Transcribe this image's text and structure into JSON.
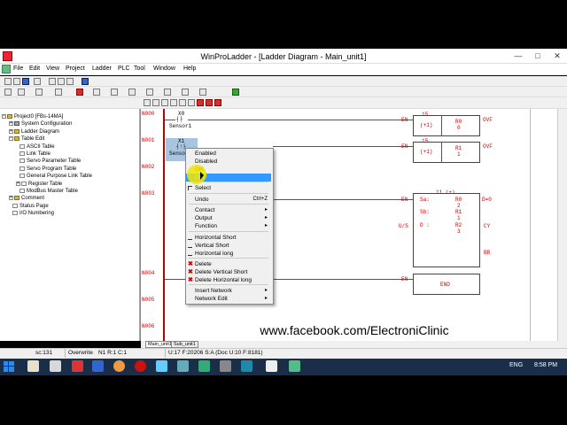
{
  "window": {
    "title": "WinProLadder - [Ladder Diagram - Main_unit1]",
    "minimize": "—",
    "maximize": "□",
    "close": "✕"
  },
  "menu": [
    "File",
    "Edit",
    "View",
    "Project",
    "Ladder",
    "PLC",
    "Tool",
    "Window",
    "Help"
  ],
  "tree": {
    "items": [
      {
        "label": "Project0 [FBs-14MA]",
        "icon": "folder-icon",
        "expander": "−"
      },
      {
        "label": "System Configuration",
        "icon": "gear-icon",
        "expander": "+"
      },
      {
        "label": "Ladder Diagram",
        "icon": "folder-icon",
        "expander": "+"
      },
      {
        "label": "Table Edit",
        "icon": "folder-icon",
        "expander": "−"
      },
      {
        "label": "ASCII Table",
        "icon": "doc-icon",
        "expander": ""
      },
      {
        "label": "Link Table",
        "icon": "doc-icon",
        "expander": ""
      },
      {
        "label": "Servo Parameter Table",
        "icon": "doc-icon",
        "expander": ""
      },
      {
        "label": "Servo Program Table",
        "icon": "doc-icon",
        "expander": ""
      },
      {
        "label": "General Purpose Link Table",
        "icon": "doc-icon",
        "expander": ""
      },
      {
        "label": "Register Table",
        "icon": "doc-icon",
        "expander": "+"
      },
      {
        "label": "ModBus Master Table",
        "icon": "doc-icon",
        "expander": ""
      },
      {
        "label": "Comment",
        "icon": "folder-icon",
        "expander": "+"
      },
      {
        "label": "Status Page",
        "icon": "doc-icon",
        "expander": ""
      },
      {
        "label": "I/O Numbering",
        "icon": "doc-icon",
        "expander": ""
      }
    ]
  },
  "ladder": {
    "rungs": [
      "N000",
      "N001",
      "N002",
      "N003",
      "N004",
      "N005",
      "N006"
    ],
    "contact0": {
      "address": "X0",
      "symbol": "┤├",
      "comment": "Sensor1"
    },
    "contact1": {
      "address": "X1",
      "symbol": "┤↑├",
      "comment": "Sensor"
    },
    "fb1": {
      "number": "15",
      "op": "(+1)",
      "reg": "R0",
      "idx": "0",
      "en": "EN",
      "out": "OVF"
    },
    "fb2": {
      "number": "15",
      "op": "(+1)",
      "reg": "R1",
      "idx": "1",
      "en": "EN",
      "out": "OVF"
    },
    "fb3": {
      "number": "11.(+)",
      "en": "EN",
      "us": "U/S",
      "sa": "Sa:",
      "sa_reg": "R0",
      "sa_idx": "2",
      "sb": "Sb:",
      "sb_reg": "R1",
      "sb_idx": "1",
      "d": "D :",
      "d_reg": "R2",
      "d_idx": "3",
      "out1": "D=0",
      "out2": "CY",
      "out3": "BR"
    },
    "fb_end": {
      "en": "EN",
      "label": "END"
    }
  },
  "context_menu": {
    "items": [
      {
        "label": "Enabled"
      },
      {
        "label": "Disabled"
      },
      {
        "label": "ON"
      },
      {
        "label": "OFF",
        "highlighted": true
      },
      {
        "label": "Select"
      },
      {
        "label": "Undo",
        "shortcut": "Ctrl+Z"
      },
      {
        "label": "Contact",
        "submenu": "▸"
      },
      {
        "label": "Output",
        "submenu": "▸"
      },
      {
        "label": "Function",
        "submenu": "▸"
      },
      {
        "label": "Horizontal Short"
      },
      {
        "label": "Vertical Short"
      },
      {
        "label": "Horizontal long"
      },
      {
        "label": "Delete"
      },
      {
        "label": "Delete Vertical Short"
      },
      {
        "label": "Delete Horizontal long"
      },
      {
        "label": "Insert Network",
        "submenu": "▸"
      },
      {
        "label": "Network Edit",
        "submenu": "▸"
      }
    ]
  },
  "watermark": "www.facebook.com/ElectroniClinic",
  "tabs": [
    "Main_unit1",
    "Sub_unit1"
  ],
  "status": {
    "scan": "sc:131",
    "mode": "Overwrite",
    "position": "N1 R:1 C:1",
    "memory": "U:17 F:20206 S:A (Doc U:10 F:8181)"
  },
  "taskbar": {
    "lang": "ENG",
    "time": "8:58 PM"
  },
  "colors": {
    "rung_label": "#cc0000",
    "selection": "#3399ff",
    "taskbar": "#1a2e4a"
  }
}
